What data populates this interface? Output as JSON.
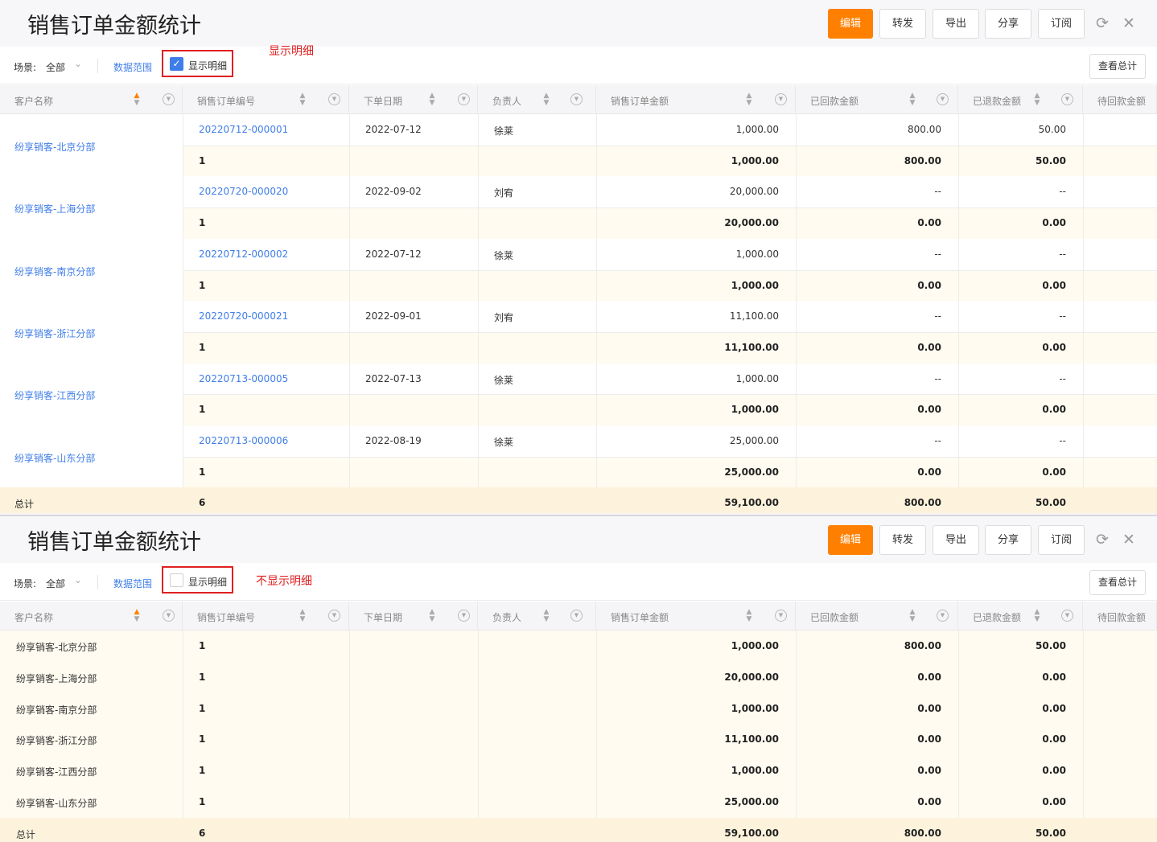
{
  "header": {
    "title": "销售订单金额统计",
    "buttons": {
      "edit": "编辑",
      "forward": "转发",
      "export": "导出",
      "share": "分享",
      "subscribe": "订阅"
    },
    "refresh_icon": "refresh-icon",
    "close_icon": "close-icon"
  },
  "filters": {
    "scene_label": "场景:",
    "scene_value": "全部",
    "data_range": "数据范围",
    "show_detail": "显示明细",
    "view_total": "查看总计"
  },
  "annotations": {
    "top": "显示明细",
    "bottom": "不显示明细"
  },
  "columns": [
    "客户名称",
    "销售订单编号",
    "下单日期",
    "负责人",
    "销售订单金额",
    "已回款金额",
    "已退款金额",
    "待回款金额"
  ],
  "colors": {
    "accent": "#ff8000",
    "link": "#3f7ee8",
    "subtotal_bg": "#fffbf0",
    "total_bg": "#fdf3dc",
    "annotation": "#e02020"
  },
  "detail_groups": [
    {
      "customer": "纷享销客-北京分部",
      "order_no": "20220712-000001",
      "date": "2022-07-12",
      "owner": "徐莱",
      "amount": "1,000.00",
      "received": "800.00",
      "refunded": "50.00",
      "sub_count": "1",
      "sub_amount": "1,000.00",
      "sub_received": "800.00",
      "sub_refunded": "50.00"
    },
    {
      "customer": "纷享销客-上海分部",
      "order_no": "20220720-000020",
      "date": "2022-09-02",
      "owner": "刘宥",
      "amount": "20,000.00",
      "received": "--",
      "refunded": "--",
      "sub_count": "1",
      "sub_amount": "20,000.00",
      "sub_received": "0.00",
      "sub_refunded": "0.00"
    },
    {
      "customer": "纷享销客-南京分部",
      "order_no": "20220712-000002",
      "date": "2022-07-12",
      "owner": "徐莱",
      "amount": "1,000.00",
      "received": "--",
      "refunded": "--",
      "sub_count": "1",
      "sub_amount": "1,000.00",
      "sub_received": "0.00",
      "sub_refunded": "0.00"
    },
    {
      "customer": "纷享销客-浙江分部",
      "order_no": "20220720-000021",
      "date": "2022-09-01",
      "owner": "刘宥",
      "amount": "11,100.00",
      "received": "--",
      "refunded": "--",
      "sub_count": "1",
      "sub_amount": "11,100.00",
      "sub_received": "0.00",
      "sub_refunded": "0.00"
    },
    {
      "customer": "纷享销客-江西分部",
      "order_no": "20220713-000005",
      "date": "2022-07-13",
      "owner": "徐莱",
      "amount": "1,000.00",
      "received": "--",
      "refunded": "--",
      "sub_count": "1",
      "sub_amount": "1,000.00",
      "sub_received": "0.00",
      "sub_refunded": "0.00"
    },
    {
      "customer": "纷享销客-山东分部",
      "order_no": "20220713-000006",
      "date": "2022-08-19",
      "owner": "徐莱",
      "amount": "25,000.00",
      "received": "--",
      "refunded": "--",
      "sub_count": "1",
      "sub_amount": "25,000.00",
      "sub_received": "0.00",
      "sub_refunded": "0.00"
    }
  ],
  "summary_rows": [
    {
      "customer": "纷享销客-北京分部",
      "count": "1",
      "amount": "1,000.00",
      "received": "800.00",
      "refunded": "50.00"
    },
    {
      "customer": "纷享销客-上海分部",
      "count": "1",
      "amount": "20,000.00",
      "received": "0.00",
      "refunded": "0.00"
    },
    {
      "customer": "纷享销客-南京分部",
      "count": "1",
      "amount": "1,000.00",
      "received": "0.00",
      "refunded": "0.00"
    },
    {
      "customer": "纷享销客-浙江分部",
      "count": "1",
      "amount": "11,100.00",
      "received": "0.00",
      "refunded": "0.00"
    },
    {
      "customer": "纷享销客-江西分部",
      "count": "1",
      "amount": "1,000.00",
      "received": "0.00",
      "refunded": "0.00"
    },
    {
      "customer": "纷享销客-山东分部",
      "count": "1",
      "amount": "25,000.00",
      "received": "0.00",
      "refunded": "0.00"
    }
  ],
  "total": {
    "label": "总计",
    "count": "6",
    "amount": "59,100.00",
    "received": "800.00",
    "refunded": "50.00"
  }
}
